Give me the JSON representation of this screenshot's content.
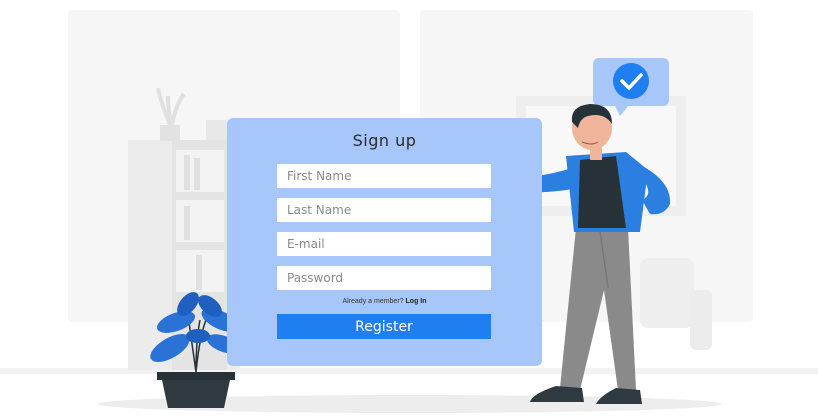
{
  "signup": {
    "title": "Sign up",
    "first_name_placeholder": "First Name",
    "last_name_placeholder": "Last Name",
    "email_placeholder": "E-mail",
    "password_placeholder": "Password",
    "member_prompt": "Already a member?",
    "login_link": "Log In",
    "register_label": "Register"
  },
  "colors": {
    "card": "#a7c7fb",
    "accent": "#1f7ff0",
    "bubble": "#a7c7fb",
    "check": "#1f7ff0",
    "jacket": "#2a7fe0",
    "shirt": "#263238",
    "pants": "#8a8a8a",
    "plant": "#2a72d6",
    "background": "#f4f4f4"
  },
  "icons": [
    "checkmark-icon",
    "plant-illustration",
    "person-illustration",
    "bookshelf-illustration",
    "lamp-illustration",
    "sofa-illustration"
  ]
}
